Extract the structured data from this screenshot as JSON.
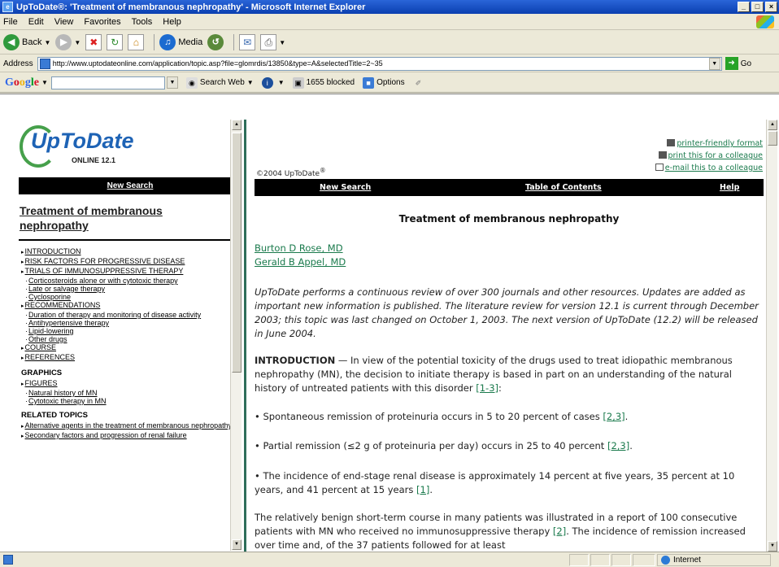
{
  "window": {
    "title": "UpToDate®: 'Treatment of membranous nephropathy' - Microsoft Internet Explorer",
    "controls": [
      "_",
      "□",
      "×"
    ]
  },
  "menu": [
    "File",
    "Edit",
    "View",
    "Favorites",
    "Tools",
    "Help"
  ],
  "navbar": {
    "back_label": "Back",
    "media_label": "Media"
  },
  "address": {
    "label": "Address",
    "url": "http://www.uptodateonline.com/application/topic.asp?file=glomrdis/13850&type=A&selectedTitle=2~35",
    "go_label": "Go"
  },
  "google_bar": {
    "logo": [
      "G",
      "o",
      "o",
      "g",
      "l",
      "e"
    ],
    "search_web": "Search Web",
    "blocked": "1655 blocked",
    "options": "Options"
  },
  "left": {
    "logo_text": "UpToDate",
    "logo_version": "ONLINE 12.1",
    "new_search": "New Search",
    "topic_title": "Treatment of membranous nephropathy",
    "toc": [
      {
        "level": 1,
        "text": "INTRODUCTION"
      },
      {
        "level": 1,
        "text": "RISK FACTORS FOR PROGRESSIVE DISEASE"
      },
      {
        "level": 1,
        "text": "TRIALS OF IMMUNOSUPPRESSIVE THERAPY"
      },
      {
        "level": 2,
        "text": "Corticosteroids alone or with cytotoxic therapy"
      },
      {
        "level": 2,
        "text": "Late or salvage therapy"
      },
      {
        "level": 2,
        "text": "Cyclosporine"
      },
      {
        "level": 1,
        "text": "RECOMMENDATIONS"
      },
      {
        "level": 2,
        "text": "Duration of therapy and monitoring of disease activity"
      },
      {
        "level": 2,
        "text": "Antihypertensive therapy"
      },
      {
        "level": 2,
        "text": "Lipid-lowering"
      },
      {
        "level": 2,
        "text": "Other drugs"
      },
      {
        "level": 1,
        "text": "COURSE"
      },
      {
        "level": 1,
        "text": "REFERENCES"
      }
    ],
    "graphics_header": "GRAPHICS",
    "graphics": [
      {
        "level": 1,
        "text": "FIGURES"
      },
      {
        "level": 2,
        "text": "Natural history of MN"
      },
      {
        "level": 2,
        "text": "Cytotoxic therapy in MN"
      }
    ],
    "related_header": "RELATED TOPICS",
    "related": [
      {
        "level": 1,
        "text": "Alternative agents in the treatment of membranous nephropathy"
      },
      {
        "level": 1,
        "text": "Secondary factors and progression of renal failure"
      }
    ]
  },
  "right": {
    "tools": [
      "printer-friendly format",
      "print this for a colleague",
      "e-mail this to a colleague"
    ],
    "copyright": "©2004 UpToDate",
    "copyright_mark": "®",
    "nav": [
      "New Search",
      "Table of Contents",
      "Help"
    ],
    "title": "Treatment of membranous nephropathy",
    "authors": [
      "Burton D Rose, MD",
      "Gerald B Appel, MD"
    ],
    "review_note": "UpToDate performs a continuous review of over 300 journals and other resources. Updates are added as important new information is published. The literature review for version 12.1 is current through December 2003; this topic was last changed on October 1, 2003. The next version of UpToDate (12.2) will be released in June 2004.",
    "intro_heading": "INTRODUCTION",
    "intro_text": " — In view of the potential toxicity of the drugs used to treat idiopathic membranous nephropathy (MN), the decision to initiate therapy is based in part on an understanding of the natural history of untreated patients with this disorder ",
    "intro_ref": "[1-3]",
    "intro_end": ":",
    "bullets": [
      {
        "text": "• Spontaneous remission of proteinuria occurs in 5 to 20 percent of cases ",
        "ref": "[2,3]",
        "end": "."
      },
      {
        "text": "• Partial remission (≤2 g of proteinuria per day) occurs in 25 to 40 percent ",
        "ref": "[2,3]",
        "end": "."
      },
      {
        "text": "• The incidence of end-stage renal disease is approximately 14 percent at five years, 35 percent at 10 years, and 41 percent at 15 years ",
        "ref": "[1]",
        "end": "."
      }
    ],
    "para2_a": "The relatively benign short-term course in many patients was illustrated in a report of 100 consecutive patients with MN who received no immunosuppressive therapy ",
    "para2_ref": "[2]",
    "para2_b": ". The incidence of remission increased over time and, of the 37 patients followed for at least"
  },
  "status": {
    "zone": "Internet"
  }
}
